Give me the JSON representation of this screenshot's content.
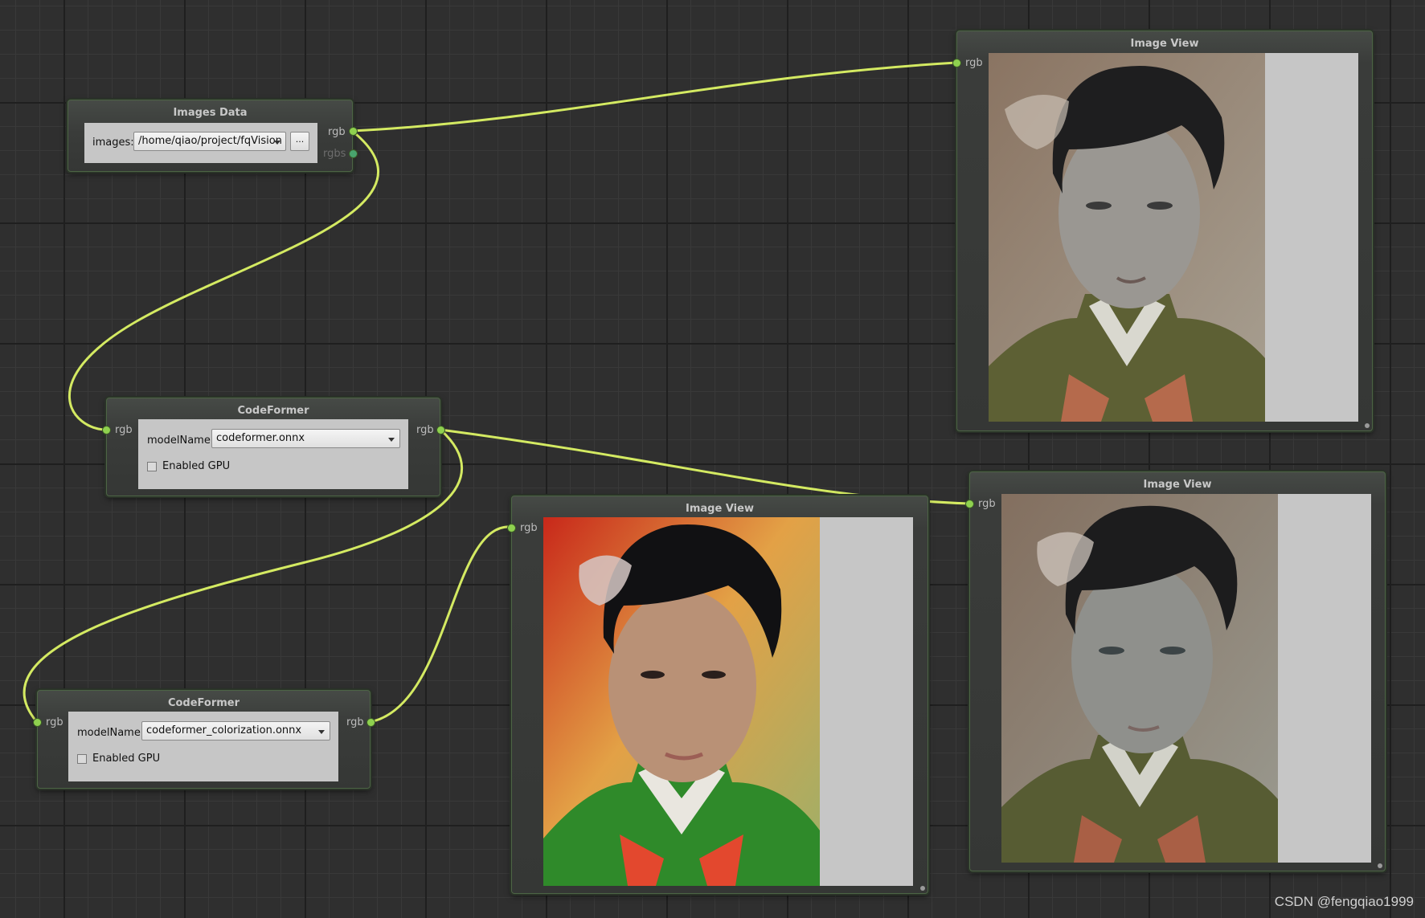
{
  "nodes": {
    "images_data": {
      "title": "Images Data",
      "images_label": "images:",
      "images_value": "/home/qiao/project/fqVision",
      "browse_label": "...",
      "out_rgb": "rgb",
      "out_rgbs": "rgbs"
    },
    "codeformer_1": {
      "title": "CodeFormer",
      "in_rgb": "rgb",
      "out_rgb": "rgb",
      "model_label": "modelName:",
      "model_value": "codeformer.onnx",
      "gpu_label": "Enabled GPU",
      "gpu_checked": false
    },
    "codeformer_2": {
      "title": "CodeFormer",
      "in_rgb": "rgb",
      "out_rgb": "rgb",
      "model_label": "modelName:",
      "model_value": "codeformer_colorization.onnx",
      "gpu_label": "Enabled GPU",
      "gpu_checked": false
    },
    "image_view_original": {
      "title": "Image View",
      "in_rgb": "rgb"
    },
    "image_view_colorized": {
      "title": "Image View",
      "in_rgb": "rgb"
    },
    "image_view_restored": {
      "title": "Image View",
      "in_rgb": "rgb"
    }
  },
  "watermark": "CSDN @fengqiao1999",
  "colors": {
    "canvas": "#2f2f2f",
    "wire": "#d4ea62",
    "port": "#8fd14f",
    "panel": "#c6c6c6"
  }
}
